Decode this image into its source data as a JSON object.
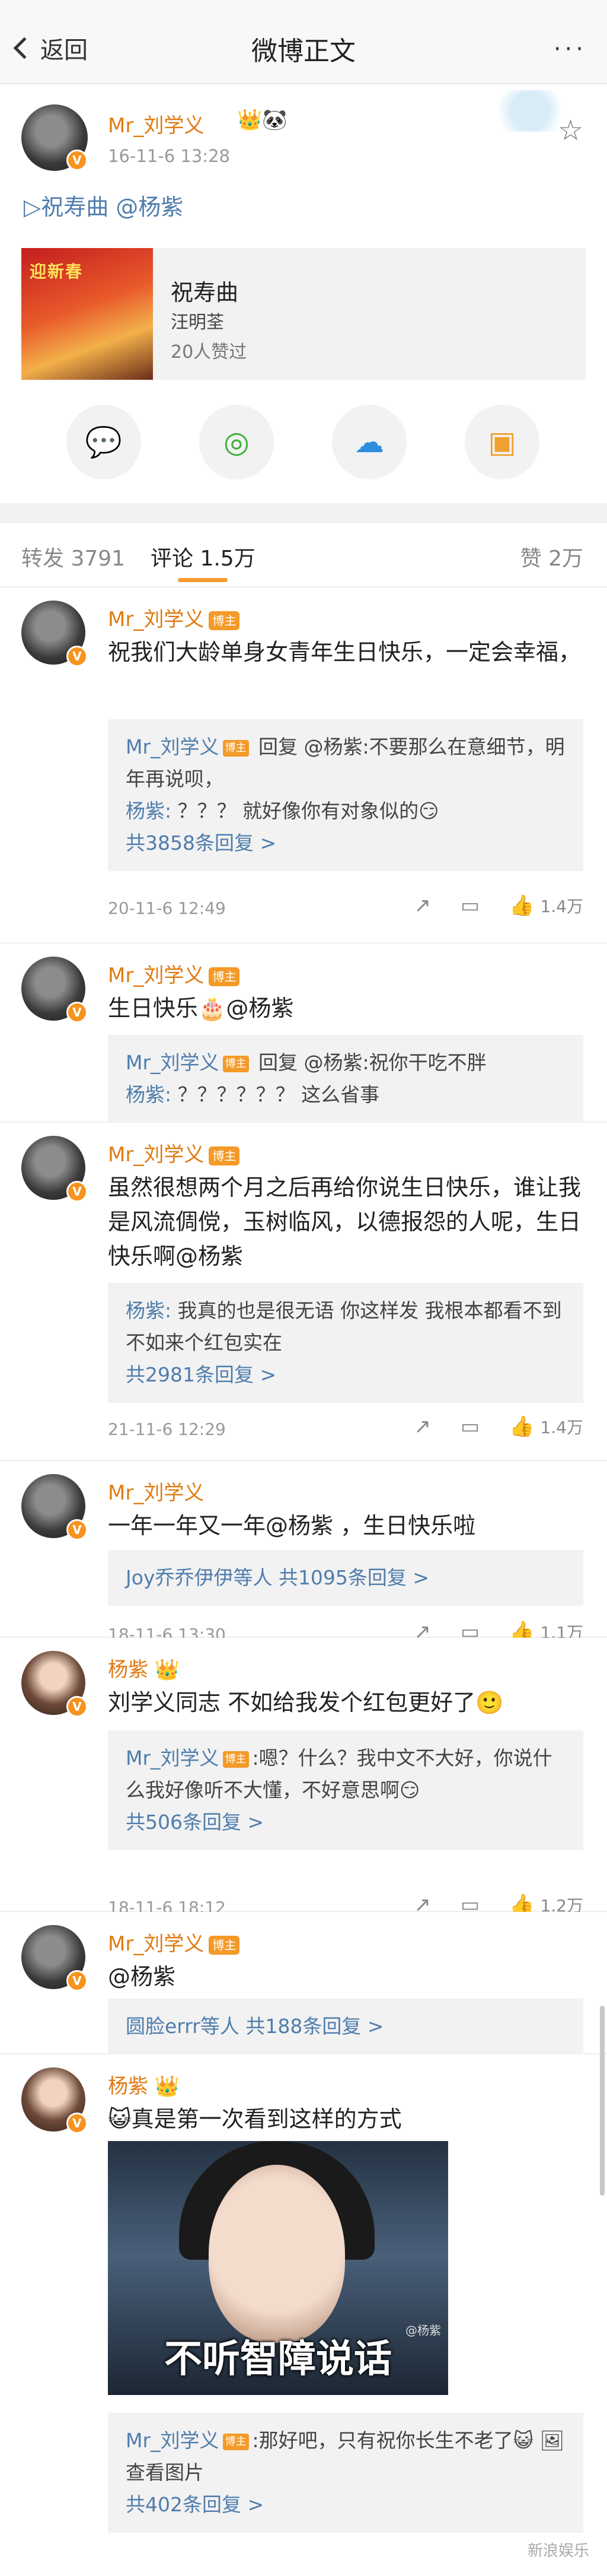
{
  "nav": {
    "back": "返回",
    "title": "微博正文",
    "more": "···"
  },
  "post": {
    "author": "Mr_刘学义",
    "emoji": "👑🐼",
    "time": "16-11-6 13:28",
    "text": "▷祝寿曲 @杨紫",
    "music": {
      "album_text": "迎新春",
      "title": "祝寿曲",
      "artist": "汪明荃",
      "likes": "20人赞过"
    },
    "share_icons": [
      "wechat-icon",
      "moments-icon",
      "qq-icon",
      "save-image-icon"
    ]
  },
  "tabs": {
    "repost": "转发 3791",
    "comment": "评论 1.5万",
    "like": "赞 2万"
  },
  "comments": [
    {
      "author": "Mr_刘学义",
      "badge": "博主",
      "text": "祝我们大龄单身女青年生日快乐，一定会幸福，",
      "replies": [
        {
          "name": "Mr_刘学义",
          "tag": "博主",
          "text": " 回复 @杨紫:不要那么在意细节，明年再说呗，"
        },
        {
          "name": "杨紫:",
          "tag": "",
          "text": " ？？？ 就好像你有对象似的😏"
        }
      ],
      "more": "共3858条回复 >",
      "time": "20-11-6 12:49",
      "likes": "1.4万"
    },
    {
      "author": "Mr_刘学义",
      "badge": "博主",
      "text": "生日快乐🎂@杨紫",
      "replies": [
        {
          "name": "Mr_刘学义",
          "tag": "博主",
          "text": " 回复 @杨紫:祝你干吃不胖"
        },
        {
          "name": "杨紫:",
          "tag": "",
          "text": " ？？？？？？ 这么省事"
        }
      ]
    },
    {
      "author": "Mr_刘学义",
      "badge": "博主",
      "text": "虽然很想两个月之后再给你说生日快乐，谁让我是风流倜傥，玉树临风，以德报怨的人呢，生日快乐啊@杨紫",
      "replies": [
        {
          "name": "杨紫:",
          "tag": "",
          "text": " 我真的也是很无语 你这样发 我根本都看不到 不如来个红包实在"
        }
      ],
      "more": "共2981条回复 >",
      "time": "21-11-6 12:29",
      "likes": "1.4万"
    },
    {
      "author": "Mr_刘学义",
      "badge": "",
      "text": "一年一年又一年@杨紫 ，生日快乐啦",
      "more": "Joy乔乔伊伊等人  共1095条回复 >",
      "time": "18-11-6 13:30",
      "likes": "1.1万"
    },
    {
      "author": "杨紫",
      "badge": "👑",
      "text": "刘学义同志 不如给我发个红包更好了🙂",
      "replies": [
        {
          "name": "Mr_刘学义",
          "tag": "博主",
          "text": ":嗯？什么？我中文不大好，你说什么我好像听不大懂，不好意思啊😏"
        }
      ],
      "more": "共506条回复 >",
      "time": "18-11-6 18:12",
      "likes": "1.2万"
    },
    {
      "author": "Mr_刘学义",
      "badge": "博主",
      "text": "@杨紫",
      "more": "圆脸errr等人  共188条回复 >"
    },
    {
      "author": "杨紫",
      "badge": "👑",
      "text": "😺真是第一次看到这样的方式",
      "meme_caption": "不听智障说话",
      "meme_mark": "@杨紫",
      "replies": [
        {
          "name": "Mr_刘学义",
          "tag": "博主",
          "text": ":那好吧，只有祝你长生不老了😺 🖼查看图片"
        }
      ],
      "more": "共402条回复 >"
    }
  ],
  "watermark": "新浪娱乐"
}
